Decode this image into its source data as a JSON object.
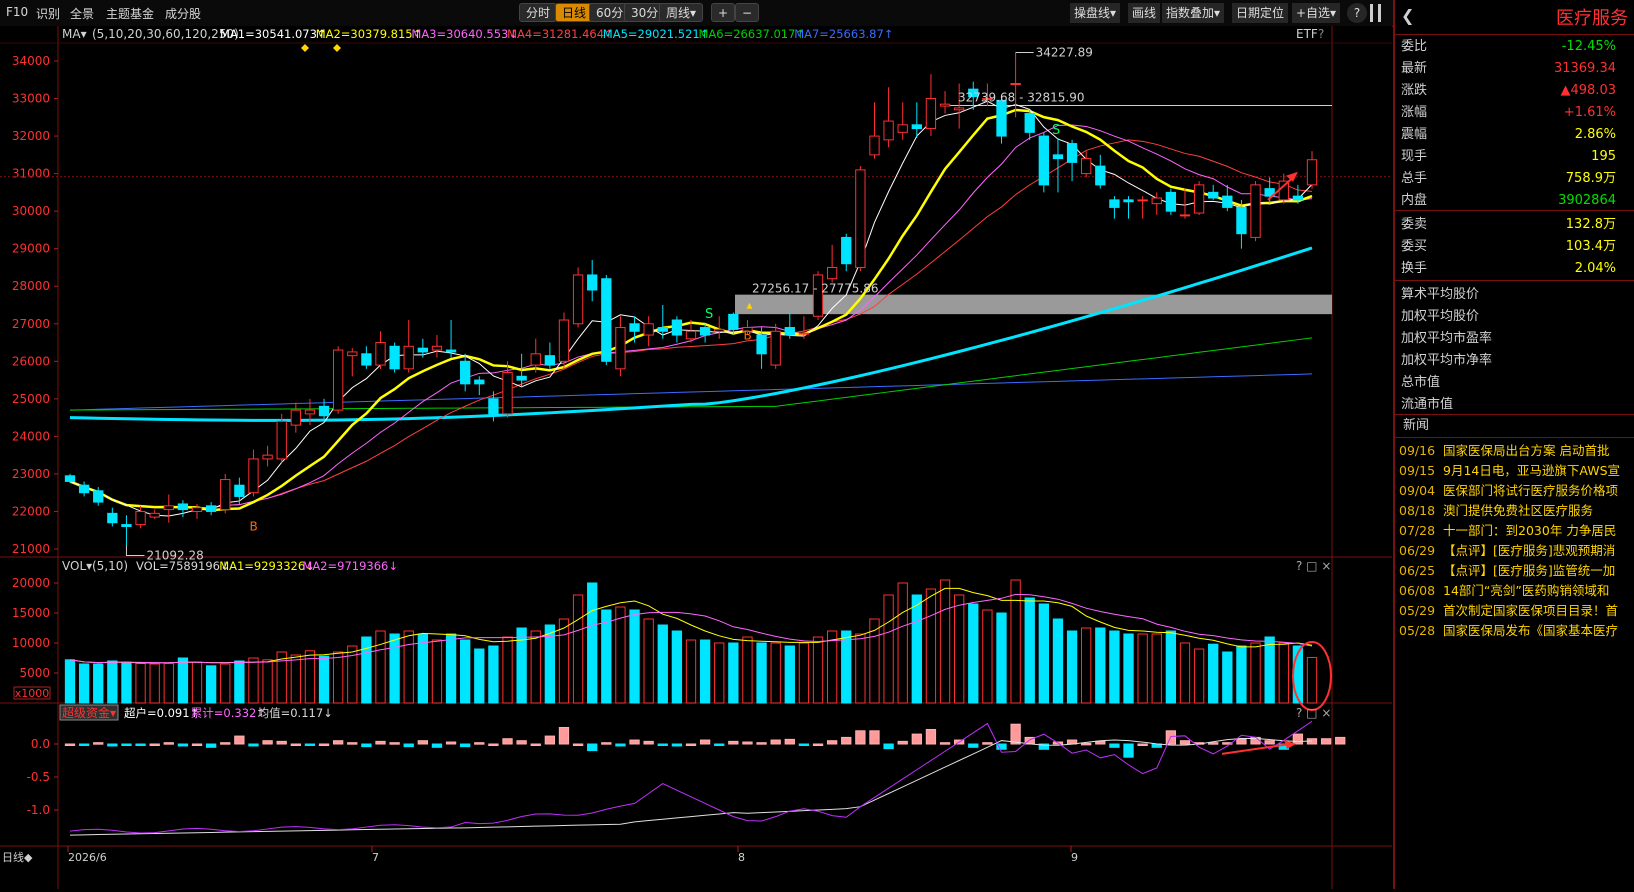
{
  "toolbar": {
    "left": [
      "F10",
      "识别",
      "全景",
      "主题基金",
      "成分股"
    ],
    "periods": [
      "分时",
      "日线",
      "60分",
      "30分",
      "周线▾"
    ],
    "active_period": "日线",
    "zoom": [
      "+",
      "−"
    ],
    "right": [
      "操盘线▾",
      "画线",
      "指数叠加▾",
      "日期定位",
      "+自选▾",
      "?"
    ]
  },
  "ma_header": {
    "label": "MA▾",
    "params": "(5,10,20,30,60,120,250)",
    "items": [
      {
        "text": "MA1=30541.073↑",
        "color": "#ffffff"
      },
      {
        "text": "MA2=30379.815↑",
        "color": "#ffff00"
      },
      {
        "text": "MA3=30640.553↓",
        "color": "#ff66ff"
      },
      {
        "text": "MA4=31281.464↑",
        "color": "#ff4040"
      },
      {
        "text": "MA5=29021.521↑",
        "color": "#00e5ff"
      },
      {
        "text": "MA6=26637.017↑",
        "color": "#00d000"
      },
      {
        "text": "MA7=25663.87↑",
        "color": "#3a6cff"
      }
    ],
    "etf": "ETF",
    "help": "?"
  },
  "vol_header": {
    "label": "VOL▾",
    "params": "(5,10)",
    "items": [
      {
        "text": "VOL=7589196↓",
        "color": "#d8d8d8"
      },
      {
        "text": "MA1=9293326↓",
        "color": "#ffff00"
      },
      {
        "text": "MA2=9719366↓",
        "color": "#ff66ff"
      }
    ],
    "controls": "? □ ×"
  },
  "fund_header": {
    "label": "超级资金▾",
    "items": [
      {
        "text": "超户=0.091↑",
        "color": "#ffffff"
      },
      {
        "text": "累计=0.332↑",
        "color": "#ff66ff"
      },
      {
        "text": "均值=0.117↓",
        "color": "#d8d8d8"
      }
    ],
    "controls": "? □ ×"
  },
  "annotations": {
    "high": "34227.89",
    "low": "21092.28",
    "resist": "32739.68 - 32815.90",
    "zone": "27256.17 - 27775.86",
    "b_marks": [
      "B",
      "B"
    ],
    "s_marks": [
      "S",
      "S"
    ]
  },
  "axes": {
    "price_ticks": [
      "34000",
      "33000",
      "32000",
      "31000",
      "30000",
      "29000",
      "28000",
      "27000",
      "26000",
      "25000",
      "24000",
      "23000",
      "22000",
      "21000"
    ],
    "vol_ticks": [
      "20000",
      "15000",
      "10000",
      "5000"
    ],
    "vol_unit": "x1000",
    "fund_ticks": [
      "0.0",
      "-0.5",
      "-1.0"
    ],
    "dates": [
      "2026/6",
      "7",
      "8",
      "9"
    ],
    "bottom_label": "日线◆"
  },
  "side": {
    "title": "医疗服务",
    "quote": [
      {
        "k": "委比",
        "v": "-12.45%",
        "c": "#00e000"
      },
      {
        "k": "最新",
        "v": "31369.34",
        "c": "#ff3030"
      },
      {
        "k": "涨跌",
        "v": "▲498.03",
        "c": "#ff3030"
      },
      {
        "k": "涨幅",
        "v": "+1.61%",
        "c": "#ff3030"
      },
      {
        "k": "震幅",
        "v": "2.86%",
        "c": "#ffff00"
      },
      {
        "k": "现手",
        "v": "195",
        "c": "#ffff00"
      },
      {
        "k": "总手",
        "v": "758.9万",
        "c": "#ffff00"
      },
      {
        "k": "内盘",
        "v": "3902864",
        "c": "#00e000"
      },
      {
        "k": "委卖",
        "v": "132.8万",
        "c": "#ffff00"
      },
      {
        "k": "委买",
        "v": "103.4万",
        "c": "#ffff00"
      },
      {
        "k": "换手",
        "v": "2.04%",
        "c": "#ffff00"
      }
    ],
    "fields": [
      "算术平均股价",
      "加权平均股价",
      "加权平均市盈率",
      "加权平均市净率",
      "总市值",
      "流通市值"
    ],
    "news_title": "新闻",
    "news": [
      {
        "d": "09/16",
        "t": "国家医保局出台方案 启动首批"
      },
      {
        "d": "09/15",
        "t": "9月14日电，亚马逊旗下AWS宣"
      },
      {
        "d": "09/04",
        "t": "医保部门将试行医疗服务价格项"
      },
      {
        "d": "08/18",
        "t": "澳门提供免费社区医疗服务"
      },
      {
        "d": "07/28",
        "t": "十一部门：到2030年 力争居民"
      },
      {
        "d": "06/29",
        "t": "【点评】[医疗服务]悲观预期消"
      },
      {
        "d": "06/25",
        "t": "【点评】[医疗服务]监管统一加"
      },
      {
        "d": "06/08",
        "t": "14部门“亮剑”医药购销领域和"
      },
      {
        "d": "05/29",
        "t": "首次制定国家医保项目目录！首"
      },
      {
        "d": "05/28",
        "t": "国家医保局发布《国家基本医疗"
      }
    ]
  },
  "chart_data": {
    "type": "candlestick",
    "title": "医疗服务",
    "ylim": [
      21000,
      34300
    ],
    "candles": [
      {
        "o": 22950,
        "c": 22800,
        "h": 23000,
        "l": 22750
      },
      {
        "o": 22700,
        "c": 22500,
        "h": 22800,
        "l": 22400
      },
      {
        "o": 22550,
        "c": 22250,
        "h": 22650,
        "l": 22150
      },
      {
        "o": 21950,
        "c": 21700,
        "h": 22100,
        "l": 21600
      },
      {
        "o": 21650,
        "c": 21600,
        "h": 21900,
        "l": 21092.28
      },
      {
        "o": 21650,
        "c": 22000,
        "h": 22150,
        "l": 21550
      },
      {
        "o": 21850,
        "c": 21950,
        "h": 22050,
        "l": 21800
      },
      {
        "o": 22050,
        "c": 22150,
        "h": 22450,
        "l": 21700
      },
      {
        "o": 22200,
        "c": 22050,
        "h": 22300,
        "l": 21850
      },
      {
        "o": 22000,
        "c": 22100,
        "h": 22200,
        "l": 21800
      },
      {
        "o": 22150,
        "c": 22000,
        "h": 22250,
        "l": 21900
      },
      {
        "o": 22050,
        "c": 22850,
        "h": 23000,
        "l": 21950
      },
      {
        "o": 22700,
        "c": 22400,
        "h": 22900,
        "l": 22200
      },
      {
        "o": 22500,
        "c": 23400,
        "h": 23650,
        "l": 22400
      },
      {
        "o": 23400,
        "c": 23500,
        "h": 23750,
        "l": 23200
      },
      {
        "o": 23400,
        "c": 24400,
        "h": 24600,
        "l": 23300
      },
      {
        "o": 24300,
        "c": 24700,
        "h": 24900,
        "l": 24100
      },
      {
        "o": 24600,
        "c": 24700,
        "h": 25000,
        "l": 24300
      },
      {
        "o": 24800,
        "c": 24550,
        "h": 25000,
        "l": 24400
      },
      {
        "o": 24700,
        "c": 26300,
        "h": 26400,
        "l": 24600
      },
      {
        "o": 26150,
        "c": 26250,
        "h": 26350,
        "l": 25600
      },
      {
        "o": 26200,
        "c": 25900,
        "h": 26400,
        "l": 25800
      },
      {
        "o": 25900,
        "c": 26500,
        "h": 26800,
        "l": 25800
      },
      {
        "o": 26400,
        "c": 25800,
        "h": 26500,
        "l": 25700
      },
      {
        "o": 25800,
        "c": 26400,
        "h": 27100,
        "l": 25700
      },
      {
        "o": 26350,
        "c": 26250,
        "h": 26600,
        "l": 26100
      },
      {
        "o": 26300,
        "c": 26400,
        "h": 26700,
        "l": 26100
      },
      {
        "o": 26300,
        "c": 26250,
        "h": 27100,
        "l": 26100
      },
      {
        "o": 26000,
        "c": 25400,
        "h": 26200,
        "l": 25200
      },
      {
        "o": 25500,
        "c": 25400,
        "h": 25600,
        "l": 25100
      },
      {
        "o": 25000,
        "c": 24600,
        "h": 25200,
        "l": 24400
      },
      {
        "o": 24600,
        "c": 25700,
        "h": 26000,
        "l": 24500
      },
      {
        "o": 25600,
        "c": 25500,
        "h": 26200,
        "l": 25300
      },
      {
        "o": 25900,
        "c": 26200,
        "h": 26600,
        "l": 25700
      },
      {
        "o": 26150,
        "c": 25900,
        "h": 26500,
        "l": 25800
      },
      {
        "o": 26000,
        "c": 27100,
        "h": 27300,
        "l": 25800
      },
      {
        "o": 27000,
        "c": 28300,
        "h": 28500,
        "l": 26900
      },
      {
        "o": 28300,
        "c": 27900,
        "h": 28700,
        "l": 27600
      },
      {
        "o": 28200,
        "c": 26000,
        "h": 28300,
        "l": 25900
      },
      {
        "o": 25800,
        "c": 26900,
        "h": 27200,
        "l": 25600
      },
      {
        "o": 27000,
        "c": 26800,
        "h": 27200,
        "l": 26500
      },
      {
        "o": 26700,
        "c": 27000,
        "h": 27200,
        "l": 26400
      },
      {
        "o": 26900,
        "c": 26800,
        "h": 27500,
        "l": 26600
      },
      {
        "o": 27100,
        "c": 26700,
        "h": 27200,
        "l": 26500
      },
      {
        "o": 26600,
        "c": 26800,
        "h": 27100,
        "l": 26500
      },
      {
        "o": 26900,
        "c": 26700,
        "h": 27000,
        "l": 26500
      },
      {
        "o": 26800,
        "c": 26850,
        "h": 27200,
        "l": 26600
      },
      {
        "o": 27250,
        "c": 26850,
        "h": 27300,
        "l": 26700
      },
      {
        "o": 26800,
        "c": 26900,
        "h": 27100,
        "l": 26700
      },
      {
        "o": 26700,
        "c": 26200,
        "h": 26900,
        "l": 25800
      },
      {
        "o": 25900,
        "c": 26800,
        "h": 27000,
        "l": 25800
      },
      {
        "o": 26900,
        "c": 26700,
        "h": 27300,
        "l": 26600
      },
      {
        "o": 26750,
        "c": 26750,
        "h": 27200,
        "l": 26600
      },
      {
        "o": 27200,
        "c": 28300,
        "h": 28400,
        "l": 27100
      },
      {
        "o": 28200,
        "c": 28500,
        "h": 29100,
        "l": 28100
      },
      {
        "o": 29300,
        "c": 28600,
        "h": 29400,
        "l": 28400
      },
      {
        "o": 28500,
        "c": 31100,
        "h": 31200,
        "l": 28400
      },
      {
        "o": 31500,
        "c": 32000,
        "h": 32900,
        "l": 31400
      },
      {
        "o": 31900,
        "c": 32400,
        "h": 33300,
        "l": 31700
      },
      {
        "o": 32100,
        "c": 32300,
        "h": 32900,
        "l": 31900
      },
      {
        "o": 32300,
        "c": 32200,
        "h": 32900,
        "l": 31950
      },
      {
        "o": 32200,
        "c": 33000,
        "h": 33650,
        "l": 32000
      },
      {
        "o": 32800,
        "c": 32850,
        "h": 33200,
        "l": 32600
      },
      {
        "o": 32700,
        "c": 32750,
        "h": 33400,
        "l": 32200
      },
      {
        "o": 33250,
        "c": 33050,
        "h": 33450,
        "l": 32700
      },
      {
        "o": 33000,
        "c": 33000,
        "h": 33400,
        "l": 32800
      },
      {
        "o": 32950,
        "c": 32000,
        "h": 33100,
        "l": 31800
      },
      {
        "o": 33400,
        "c": 33400,
        "h": 34227.89,
        "l": 32500
      },
      {
        "o": 32600,
        "c": 32100,
        "h": 32700,
        "l": 31900
      },
      {
        "o": 32000,
        "c": 30700,
        "h": 32100,
        "l": 30500
      },
      {
        "o": 31500,
        "c": 31400,
        "h": 31950,
        "l": 30500
      },
      {
        "o": 31800,
        "c": 31300,
        "h": 31900,
        "l": 30800
      },
      {
        "o": 31000,
        "c": 31400,
        "h": 31600,
        "l": 30900
      },
      {
        "o": 31200,
        "c": 30700,
        "h": 31500,
        "l": 30600
      },
      {
        "o": 30300,
        "c": 30100,
        "h": 30400,
        "l": 29800
      },
      {
        "o": 30300,
        "c": 30250,
        "h": 30400,
        "l": 29800
      },
      {
        "o": 30300,
        "c": 30300,
        "h": 30400,
        "l": 29800
      },
      {
        "o": 30200,
        "c": 30350,
        "h": 30500,
        "l": 29900
      },
      {
        "o": 30500,
        "c": 30000,
        "h": 30600,
        "l": 29900
      },
      {
        "o": 29900,
        "c": 29900,
        "h": 30600,
        "l": 29800
      },
      {
        "o": 29950,
        "c": 30700,
        "h": 30800,
        "l": 29900
      },
      {
        "o": 30500,
        "c": 30350,
        "h": 30700,
        "l": 30300
      },
      {
        "o": 30400,
        "c": 30100,
        "h": 30700,
        "l": 30000
      },
      {
        "o": 30100,
        "c": 29400,
        "h": 30300,
        "l": 29000
      },
      {
        "o": 29300,
        "c": 30700,
        "h": 30800,
        "l": 29200
      },
      {
        "o": 30600,
        "c": 30400,
        "h": 30900,
        "l": 30200
      },
      {
        "o": 30300,
        "c": 30800,
        "h": 31000,
        "l": 30200
      },
      {
        "o": 30400,
        "c": 30300,
        "h": 30700,
        "l": 30200
      },
      {
        "o": 30700,
        "c": 31369.34,
        "h": 31600,
        "l": 30600
      }
    ],
    "volume_x1000": [
      7200,
      6500,
      6500,
      7000,
      6800,
      6600,
      6500,
      6600,
      7500,
      6800,
      6200,
      6500,
      7000,
      7500,
      7200,
      8500,
      8000,
      8700,
      7800,
      8500,
      9500,
      11000,
      12000,
      11500,
      12000,
      11500,
      10500,
      11500,
      10500,
      9000,
      9500,
      11000,
      12500,
      12000,
      13000,
      14000,
      18000,
      20000,
      15500,
      16000,
      15500,
      14000,
      13000,
      12000,
      10500,
      10500,
      10000,
      10000,
      11000,
      10000,
      10000,
      9500,
      10000,
      11000,
      12000,
      12000,
      11500,
      14000,
      18000,
      20000,
      18000,
      19000,
      20500,
      18000,
      16500,
      15500,
      15000,
      20500,
      17500,
      16500,
      14000,
      12000,
      12500,
      12500,
      12000,
      11500,
      11500,
      11500,
      12000,
      10000,
      9000,
      9800,
      8500,
      9500,
      10000,
      11000,
      10000,
      9500,
      7589.196
    ],
    "fund_bars": [
      0.0,
      -0.02,
      0.02,
      -0.03,
      -0.02,
      -0.01,
      0.0,
      0.02,
      -0.03,
      0.0,
      -0.05,
      0.02,
      0.12,
      -0.03,
      0.05,
      0.04,
      0.0,
      -0.01,
      0.0,
      0.05,
      0.02,
      -0.04,
      0.04,
      0.02,
      -0.04,
      0.05,
      -0.05,
      0.03,
      -0.04,
      0.02,
      0.0,
      0.08,
      0.05,
      0.0,
      0.12,
      0.25,
      0.0,
      -0.1,
      0.02,
      -0.03,
      0.06,
      0.04,
      -0.02,
      -0.03,
      0.0,
      0.06,
      -0.02,
      0.04,
      0.03,
      0.02,
      0.06,
      0.07,
      -0.02,
      0.0,
      0.05,
      0.1,
      0.2,
      0.2,
      -0.07,
      0.04,
      0.15,
      0.22,
      0.02,
      0.06,
      -0.05,
      0.02,
      -0.08,
      0.3,
      0.1,
      -0.08,
      0.03,
      0.06,
      0.01,
      0.04,
      -0.05,
      -0.2,
      0.0,
      -0.05,
      0.2,
      0.05,
      0.02,
      0.02,
      0.02,
      0.08,
      0.1,
      0.05,
      -0.08,
      0.15,
      0.08,
      0.08,
      0.1
    ],
    "x_labels": [
      "2026/6",
      "7",
      "8",
      "9"
    ]
  }
}
